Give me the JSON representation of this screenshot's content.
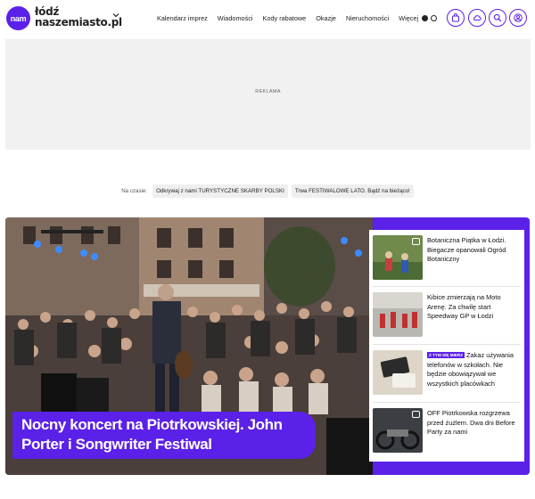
{
  "brand": {
    "logo_badge": "nam",
    "city_line": "łódź",
    "site_line": "naszemiasto.pl"
  },
  "nav": {
    "items": [
      "Kalendarz imprez",
      "Wiadomości",
      "Kody rabatowe",
      "Okazje",
      "Nieruchomości"
    ],
    "more_label": "Więcej"
  },
  "header_icons": [
    "theme-toggle-icon",
    "bag-icon",
    "weather-icon",
    "search-icon",
    "user-icon"
  ],
  "ad": {
    "label": "REKLAMA"
  },
  "trending": {
    "label": "Na czasie:",
    "chips": [
      "Odkrywaj z nami TURYSTYCZNE SKARBY POLSKI",
      "Trwa FESTIWALOWE LATO. Bądź na bieżąco!"
    ]
  },
  "hero": {
    "title": "Nocny koncert na Piotrkowskiej. John Porter i Songwriter Festiwal"
  },
  "side_list": [
    {
      "tag": "",
      "title": "Botaniczna Piątka w Łodzi. Biegacze opanowali Ogród Botaniczny",
      "has_gallery": true
    },
    {
      "tag": "",
      "title": "Kibice zmierzają na Moto Arenę. Za chwilę start Speedway GP w Łodzi",
      "has_gallery": false
    },
    {
      "tag": "Z TYM SIĘ MIERZ",
      "title": "Zakaz używania telefonów w szkołach. Nie będzie obowiązywał we wszystkich placówkach",
      "has_gallery": false
    },
    {
      "tag": "",
      "title": "OFF Piotrkowska rozgrzewa przed żużlem. Dwa dni Before Party za nami",
      "has_gallery": true
    }
  ],
  "colors": {
    "brand_purple": "#5b21e8",
    "ad_gray": "#f1f1f1",
    "chip_gray": "#efefef"
  }
}
